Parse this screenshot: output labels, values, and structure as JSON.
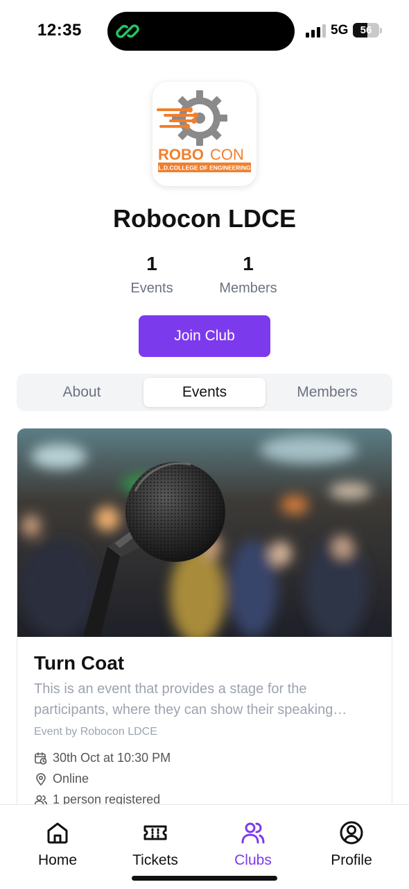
{
  "status_bar": {
    "time": "12:35",
    "network": "5G",
    "battery": "56",
    "battery_level": 0.56,
    "signal_bars": 3
  },
  "club": {
    "name": "Robocon LDCE",
    "logo": {
      "text_robo": "ROBO",
      "text_con": "CON",
      "subtitle": "L.D.COLLEGE OF ENGINEERING"
    },
    "stats": [
      {
        "value": "1",
        "label": "Events"
      },
      {
        "value": "1",
        "label": "Members"
      }
    ],
    "join_label": "Join Club"
  },
  "tabs": [
    {
      "label": "About",
      "active": false
    },
    {
      "label": "Events",
      "active": true
    },
    {
      "label": "Members",
      "active": false
    }
  ],
  "event": {
    "title": "Turn Coat",
    "description": "This is an event that provides a stage for the participants, where they can show their speaking…",
    "by": "Event by Robocon LDCE",
    "date": "30th Oct at 10:30 PM",
    "location": "Online",
    "registered": "1 person registered",
    "image_icon": "microphone-photo"
  },
  "bottom_nav": [
    {
      "label": "Home",
      "icon": "home-icon",
      "active": false
    },
    {
      "label": "Tickets",
      "icon": "ticket-icon",
      "active": false
    },
    {
      "label": "Clubs",
      "icon": "users-icon",
      "active": true
    },
    {
      "label": "Profile",
      "icon": "user-circle-icon",
      "active": false
    }
  ],
  "colors": {
    "accent": "#7c3aed",
    "logo_orange": "#f07f2d",
    "logo_gray": "#8a8a8a",
    "muted": "#6b7280"
  }
}
